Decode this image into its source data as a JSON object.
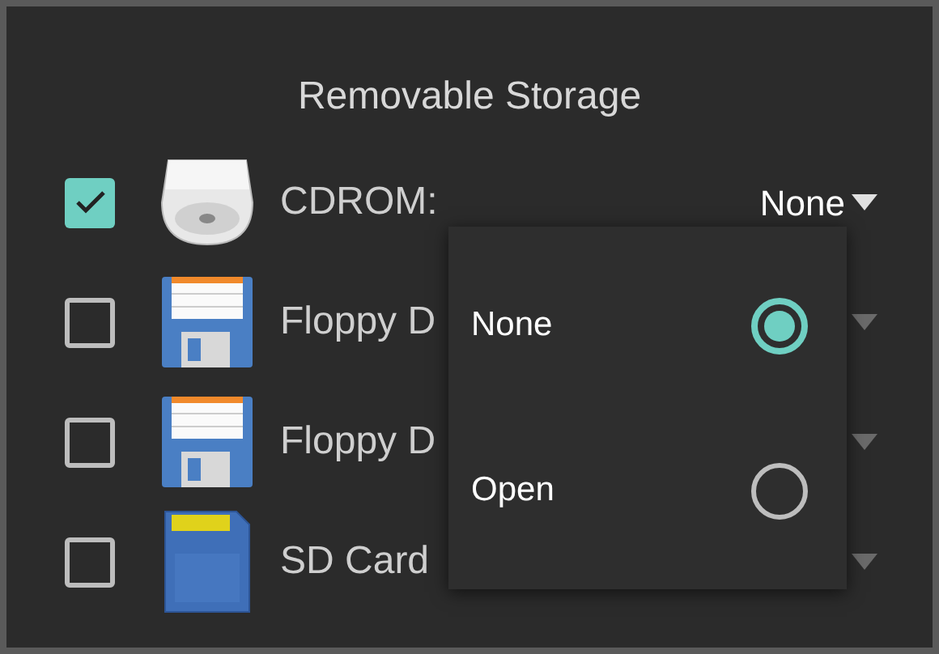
{
  "title": "Removable Storage",
  "devices": [
    {
      "kind": "cdrom",
      "label": "CDROM:",
      "checked": true,
      "value": "None"
    },
    {
      "kind": "floppy",
      "label": "Floppy D",
      "checked": false
    },
    {
      "kind": "floppy",
      "label": "Floppy D",
      "checked": false
    },
    {
      "kind": "sdcard",
      "label": "SD Card",
      "checked": false
    }
  ],
  "menu": {
    "options": [
      {
        "label": "None",
        "selected": true
      },
      {
        "label": "Open",
        "selected": false
      }
    ]
  }
}
